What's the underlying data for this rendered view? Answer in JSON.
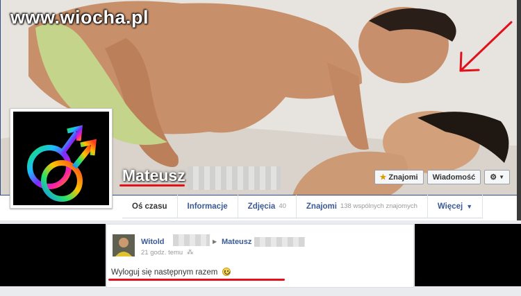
{
  "watermark": "www.wiocha.pl",
  "profile": {
    "name": "Mateusz"
  },
  "cover_buttons": {
    "friends": "Znajomi",
    "message": "Wiadomość",
    "settings_caret": "▼"
  },
  "tabs": [
    {
      "label": "Oś czasu",
      "count": ""
    },
    {
      "label": "Informacje",
      "count": ""
    },
    {
      "label": "Zdjęcia",
      "count": "40"
    },
    {
      "label": "Znajomi",
      "count": "138 wspólnych znajomych"
    },
    {
      "label": "Więcej",
      "count": ""
    }
  ],
  "post": {
    "author": "Witold",
    "target": "Mateusz",
    "time": "21 godz. temu",
    "body": "Wyloguj się następnym razem"
  },
  "colors": {
    "link": "#3b5998",
    "annotation_red": "#e2101a"
  },
  "icons": [
    "star-icon",
    "gear-icon",
    "chevron-down-icon",
    "smiley-icon",
    "people-icon",
    "arrow-right-icon"
  ]
}
